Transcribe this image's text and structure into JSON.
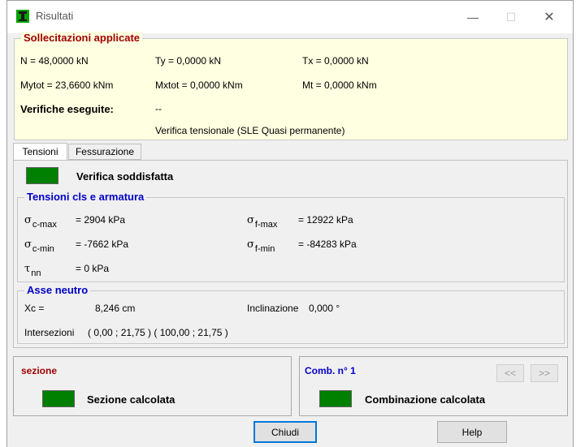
{
  "window": {
    "title": "Risultati",
    "minimize_glyph": "—",
    "maximize_glyph": "☐",
    "close_glyph": "✕",
    "icon": "app-structure-icon"
  },
  "sollecitazioni": {
    "legend": "Sollecitazioni applicate",
    "N": "N = 48,0000 kN",
    "Ty": "Ty = 0,0000 kN",
    "Tx": "Tx = 0,0000 kN",
    "Mytot": "Mytot = 23,6600 kNm",
    "Mxtot": "Mxtot = 0,0000 kNm",
    "Mt": "Mt = 0,0000 kNm",
    "verifiche_label": "Verifiche eseguite:",
    "verifiche_value": "--",
    "verifica_tipo": "Verifica tensionale (SLE Quasi permanente)"
  },
  "tabs": [
    {
      "label": "Tensioni",
      "active": true
    },
    {
      "label": "Fessurazione",
      "active": false
    }
  ],
  "status": {
    "label": "Verifica soddisfatta",
    "color": "#008000"
  },
  "tensioni": {
    "legend": "Tensioni cls e armatura",
    "sigma": "σ",
    "tau": "τ",
    "c_max_sub": "c-max",
    "c_max_val": "= 2904 kPa",
    "c_min_sub": "c-min",
    "c_min_val": "= -7662 kPa",
    "nn_sub": "nn",
    "nn_val": "= 0 kPa",
    "f_max_sub": "f-max",
    "f_max_val": "= 12922 kPa",
    "f_min_sub": "f-min",
    "f_min_val": "= -84283 kPa"
  },
  "asse": {
    "legend": "Asse neutro",
    "xc_label": "Xc =",
    "xc_value": "8,246 cm",
    "incl_label": "Inclinazione",
    "incl_value": "0,000 °",
    "inter_label": "Intersezioni",
    "inter_value": "( 0,00 ; 21,75 ) ( 100,00 ; 21,75 )"
  },
  "sezione": {
    "title": "sezione",
    "status": "Sezione calcolata"
  },
  "comb": {
    "title": "Comb. n° 1",
    "prev": "<<",
    "next": ">>",
    "status": "Combinazione calcolata"
  },
  "buttons": {
    "close": "Chiudi",
    "help": "Help"
  },
  "colors": {
    "legend_red": "#a00000",
    "legend_blue": "#0000c8",
    "panel_yellow": "#ffffe1",
    "status_green": "#008000"
  }
}
